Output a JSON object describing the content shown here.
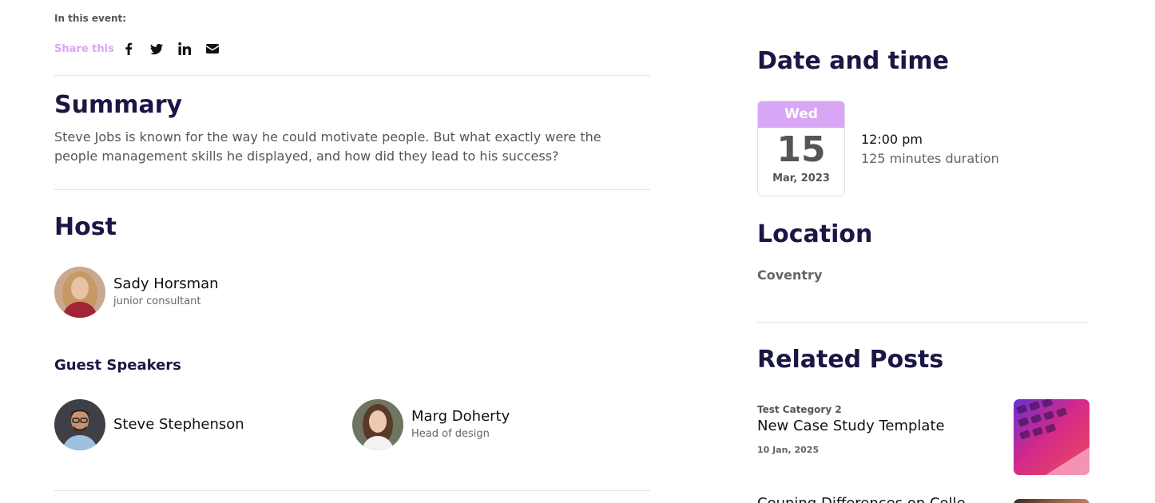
{
  "event": {
    "in_this_event": "In this event:",
    "share_label": "Share this",
    "share_icons": [
      "facebook-icon",
      "twitter-icon",
      "linkedin-icon",
      "envelope-icon"
    ]
  },
  "summary": {
    "heading": "Summary",
    "text": "Steve Jobs is known for the way he could motivate people. But what exactly were the people management skills he displayed, and how did they lead to his success?"
  },
  "host": {
    "heading": "Host",
    "name": "Sady Horsman",
    "role": "junior consultant"
  },
  "guests": {
    "heading": "Guest Speakers",
    "speakers": [
      {
        "name": "Steve Stephenson",
        "role": ""
      },
      {
        "name": "Marg Doherty",
        "role": "Head of design"
      }
    ]
  },
  "datetime": {
    "heading": "Date and time",
    "day": "Wed",
    "date": "15",
    "month_year": "Mar, 2023",
    "time": "12:00 pm",
    "duration": "125 minutes duration"
  },
  "location": {
    "heading": "Location",
    "value": "Coventry"
  },
  "related": {
    "heading": "Related Posts",
    "posts": [
      {
        "category": "Test Category 2",
        "title": "New Case Study Template",
        "date": "10 Jan, 2025"
      },
      {
        "title": "Couning Differences on Colle"
      }
    ]
  },
  "colors": {
    "accent": "#d9a5f5",
    "heading": "#1a1745",
    "muted": "#555555"
  }
}
